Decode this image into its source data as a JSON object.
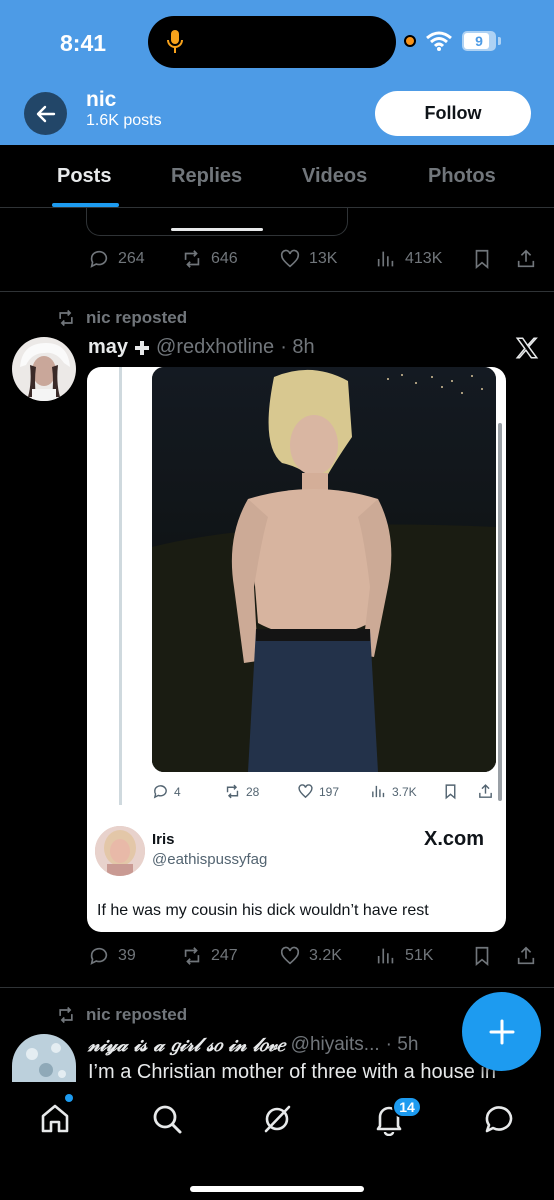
{
  "status_bar": {
    "time": "8:41",
    "battery": "9"
  },
  "header": {
    "name": "nic",
    "posts_count": "1.6K posts",
    "follow_label": "Follow"
  },
  "tabs": [
    {
      "label": "Posts"
    },
    {
      "label": "Replies"
    },
    {
      "label": "Videos"
    },
    {
      "label": "Photos"
    }
  ],
  "prev_post": {
    "replies": "264",
    "reposts": "646",
    "likes": "13K",
    "views": "413K"
  },
  "repost1": {
    "reposted_by": "nic reposted",
    "author_name": "may",
    "author_handle": "@redxhotline",
    "time": "· 8h",
    "embed": {
      "replies": "4",
      "reposts": "28",
      "likes": "197",
      "views": "3.7K",
      "reply_author_name": "Iris",
      "reply_author_handle": "@eathispussyfag",
      "source_label": "X.com",
      "text": "If he was my cousin his dick wouldn’t have rest"
    },
    "replies": "39",
    "reposts": "247",
    "likes": "3.2K",
    "views": "51K"
  },
  "repost2": {
    "reposted_by": "nic reposted",
    "author_name": "𝓃𝒾𝓎𝒶 𝒾𝓈 𝒶 𝑔𝒾𝓇𝓁 𝓈𝑜 𝒾𝓃 𝓁𝑜𝓋𝑒",
    "author_handle": "@hiyaits...",
    "time": "· 5h",
    "text": "I’m a Christian mother of three with a house in"
  },
  "bottom_nav": {
    "notification_count": "14"
  },
  "colors": {
    "accent": "#1d9bf0",
    "banner": "#4d9be6"
  }
}
